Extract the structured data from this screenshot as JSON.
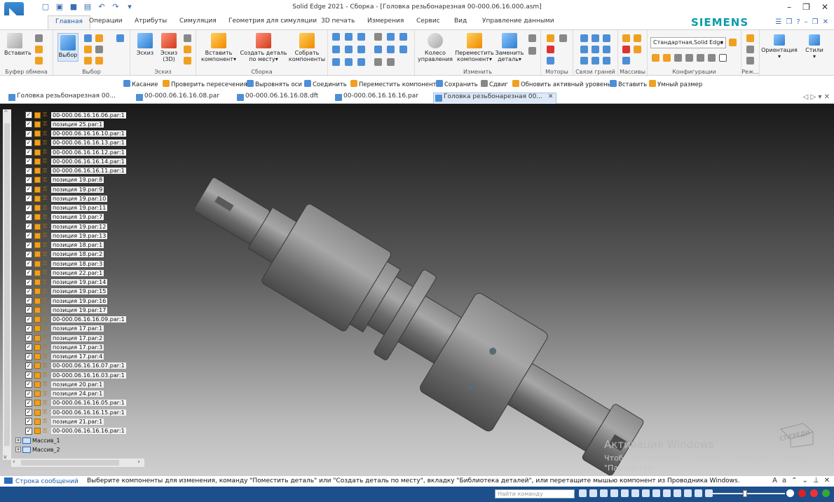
{
  "window": {
    "title": "Solid Edge 2021 - Сборка - [Головка резьбонарезная 00-000.06.16.000.asm]"
  },
  "ribbon_tabs": [
    "Главная",
    "Операции",
    "Атрибуты",
    "Симуляция",
    "Геометрия для симуляции",
    "3D печать",
    "Измерения",
    "Сервис",
    "Вид",
    "Управление данными"
  ],
  "brand": "SIEMENS",
  "ribbon": {
    "clipboard": {
      "paste": "Вставить",
      "group": "Буфер обмена"
    },
    "select": {
      "select": "Выбор",
      "group": "Выбор"
    },
    "sketch": {
      "sketch": "Эскиз",
      "sketch3d_1": "Эскиз",
      "sketch3d_2": "(3D)",
      "group": "Эскиз"
    },
    "assembly": {
      "insert_1": "Вставить",
      "insert_2": "компонент",
      "create_1": "Создать деталь",
      "create_2": "по месту",
      "build_1": "Собрать",
      "build_2": "компоненты",
      "group": "Сборка"
    },
    "modify": {
      "wheel_1": "Колесо",
      "wheel_2": "управления",
      "move_1": "Переместить",
      "move_2": "компонент",
      "replace_1": "Заменить",
      "replace_2": "деталь",
      "group": "Изменить"
    },
    "motors": "Моторы",
    "face_rel": "Связи граней",
    "arrays": "Массивы",
    "config_select": "Стандартная,Solid Edge",
    "configs": "Конфигурации",
    "modes": "Реж...",
    "orientation": "Ориентация",
    "styles": "Стили"
  },
  "command_bar": [
    "Касание",
    "Проверить пересечения",
    "Выровнять оси",
    "Соединить",
    "Переместить компонент",
    "Сохранить",
    "Сдвиг",
    "Обновить активный уровень",
    "Вставить",
    "Умный размер"
  ],
  "doc_tabs": [
    {
      "label": "Головка резьбонарезная 00..."
    },
    {
      "label": "00-000.06.16.16.08.par"
    },
    {
      "label": "00-000.06.16.16.08.dft"
    },
    {
      "label": "00-000.06.16.16.16.par"
    },
    {
      "label": "Головка резьбонарезная 00..."
    }
  ],
  "tree_items": [
    "00-000.06.16.16.06.par:1",
    "позиция 25.par:1",
    "00-000.06.16.16.10.par:1",
    "00-000.06.16.16.13.par:1",
    "00-000.06.16.16.12.par:1",
    "00-000.06.16.16.14.par:1",
    "00-000.06.16.16.11.par:1",
    "позиция 19.par:8",
    "позиция 19.par:9",
    "позиция 19.par:10",
    "позиция 19.par:11",
    "позиция 19.par:7",
    "позиция 19.par:12",
    "позиция 19.par:13",
    "позиция 18.par:1",
    "позиция 18.par:2",
    "позиция 18.par:3",
    "позиция 22.par:1",
    "позиция 19.par:14",
    "позиция 19.par:15",
    "позиция 19.par:16",
    "позиция 19.par:17",
    "00-000.06.16.16.09.par:1",
    "позиция 17.par:1",
    "позиция 17.par:2",
    "позиция 17.par:3",
    "позиция 17.par:4",
    "00-000.06.16.16.07.par:1",
    "00-000.06.16.16.03.par:1",
    "позиция 20.par:1",
    "позиция 24.par:1",
    "00-000.06.16.16.05.par:1",
    "00-000.06.16.16.15.par:1",
    "позиция 21.par:1",
    "00-000.06.16.16.16.par:1"
  ],
  "tree_arrays": [
    "Массив_1",
    "Массив_2"
  ],
  "view_cube": "СПЕРЕДИ",
  "activation": {
    "title": "Активация Windows",
    "text": "Чтобы активировать Windows, перейдите в раздел \"Параметры\"."
  },
  "status": {
    "tab": "Строка сообщений",
    "message": "Выберите компоненты для изменения, команду \"Поместить деталь\" или \"Создать деталь по месту\", вкладку \"Библиотека деталей\", или перетащите мышью компонент из Проводника Windows."
  },
  "command_search": {
    "placeholder": "Найти команду"
  }
}
